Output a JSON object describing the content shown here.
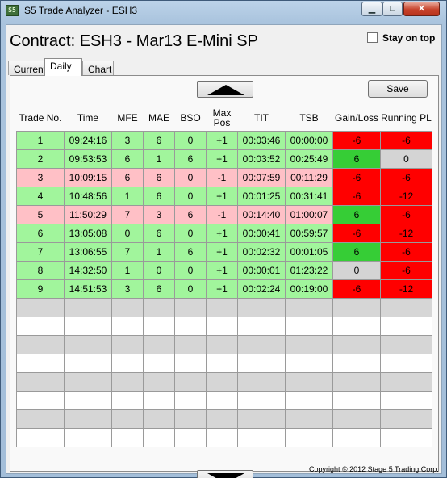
{
  "window": {
    "title": "S5 Trade Analyzer - ESH3",
    "icon_text": "S5",
    "minimize_glyph": "▁",
    "maximize_glyph": "□",
    "close_glyph": "✕"
  },
  "header": {
    "contract_title": "Contract: ESH3 - Mar13 E-Mini SP",
    "stay_on_top_label": "Stay on top",
    "stay_on_top_checked": false
  },
  "tabs": [
    {
      "label": "Current",
      "selected": false
    },
    {
      "label": "Daily",
      "selected": true
    },
    {
      "label": "Chart",
      "selected": false
    }
  ],
  "toolbar": {
    "save_label": "Save",
    "scroll_up_icon": "triangle-up",
    "scroll_down_icon": "triangle-down"
  },
  "table": {
    "columns": [
      "Trade No.",
      "Time",
      "MFE",
      "MAE",
      "BSO",
      "Max\nPos",
      "TIT",
      "TSB",
      "Gain/Loss",
      "Running PL"
    ],
    "rows": [
      {
        "row_color": "green",
        "cells": [
          "1",
          "09:24:16",
          "3",
          "6",
          "0",
          "+1",
          "00:03:46",
          "00:00:00",
          "-6",
          "-6"
        ],
        "gain_color": "red",
        "pl_color": "red"
      },
      {
        "row_color": "green",
        "cells": [
          "2",
          "09:53:53",
          "6",
          "1",
          "6",
          "+1",
          "00:03:52",
          "00:25:49",
          "6",
          "0"
        ],
        "gain_color": "green",
        "pl_color": "gray"
      },
      {
        "row_color": "pink",
        "cells": [
          "3",
          "10:09:15",
          "6",
          "6",
          "0",
          "-1",
          "00:07:59",
          "00:11:29",
          "-6",
          "-6"
        ],
        "gain_color": "red",
        "pl_color": "red"
      },
      {
        "row_color": "green",
        "cells": [
          "4",
          "10:48:56",
          "1",
          "6",
          "0",
          "+1",
          "00:01:25",
          "00:31:41",
          "-6",
          "-12"
        ],
        "gain_color": "red",
        "pl_color": "red"
      },
      {
        "row_color": "pink",
        "cells": [
          "5",
          "11:50:29",
          "7",
          "3",
          "6",
          "-1",
          "00:14:40",
          "01:00:07",
          "6",
          "-6"
        ],
        "gain_color": "green",
        "pl_color": "red"
      },
      {
        "row_color": "green",
        "cells": [
          "6",
          "13:05:08",
          "0",
          "6",
          "0",
          "+1",
          "00:00:41",
          "00:59:57",
          "-6",
          "-12"
        ],
        "gain_color": "red",
        "pl_color": "red"
      },
      {
        "row_color": "green",
        "cells": [
          "7",
          "13:06:55",
          "7",
          "1",
          "6",
          "+1",
          "00:02:32",
          "00:01:05",
          "6",
          "-6"
        ],
        "gain_color": "green",
        "pl_color": "red"
      },
      {
        "row_color": "green",
        "cells": [
          "8",
          "14:32:50",
          "1",
          "0",
          "0",
          "+1",
          "00:00:01",
          "01:23:22",
          "0",
          "-6"
        ],
        "gain_color": "gray",
        "pl_color": "red"
      },
      {
        "row_color": "green",
        "cells": [
          "9",
          "14:51:53",
          "3",
          "6",
          "0",
          "+1",
          "00:02:24",
          "00:19:00",
          "-6",
          "-12"
        ],
        "gain_color": "red",
        "pl_color": "red"
      }
    ],
    "empty_rows": [
      "gray",
      "white",
      "gray",
      "white",
      "gray",
      "white",
      "gray",
      "white"
    ]
  },
  "footer": {
    "copyright": "Copyright © 2012 Stage 5 Trading Corp."
  },
  "colors": {
    "row_green": "#a1f59c",
    "row_pink": "#ffc0c6",
    "cell_red": "#ff0000",
    "cell_green": "#36cd36",
    "cell_gray": "#d4d4d4"
  }
}
